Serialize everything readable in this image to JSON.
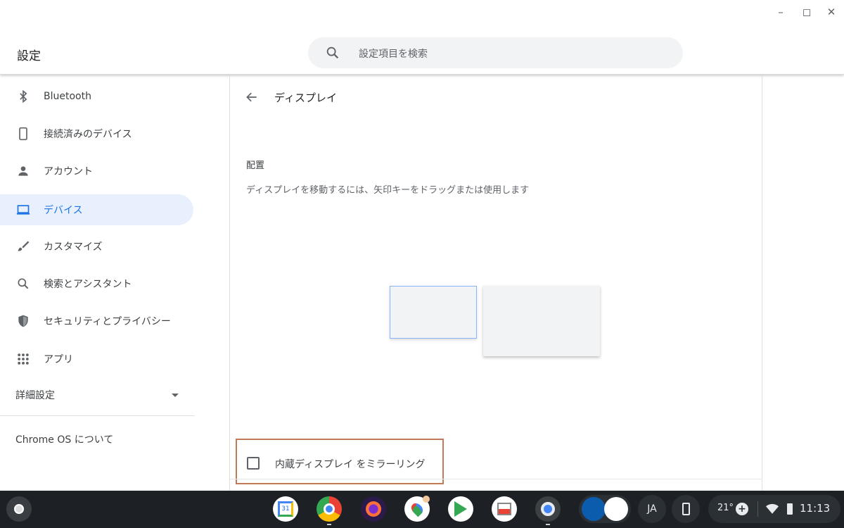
{
  "window": {
    "minimize": "–",
    "maximize": "◻",
    "close": "✕"
  },
  "header": {
    "title": "設定",
    "search_placeholder": "設定項目を検索"
  },
  "sidebar": {
    "items": [
      {
        "label": "Bluetooth",
        "icon": "bluetooth-icon"
      },
      {
        "label": "接続済みのデバイス",
        "icon": "phone-icon"
      },
      {
        "label": "アカウント",
        "icon": "person-icon"
      },
      {
        "label": "デバイス",
        "icon": "laptop-icon",
        "active": true
      },
      {
        "label": "カスタマイズ",
        "icon": "brush-icon"
      },
      {
        "label": "検索とアシスタント",
        "icon": "search-icon"
      },
      {
        "label": "セキュリティとプライバシー",
        "icon": "shield-icon"
      },
      {
        "label": "アプリ",
        "icon": "apps-grid-icon"
      }
    ],
    "advanced": "詳細設定",
    "about": "Chrome OS について"
  },
  "content": {
    "title": "ディスプレイ",
    "arrangement_heading": "配置",
    "arrangement_desc": "ディスプレイを移動するには、矢印キーをドラッグまたは使用します",
    "mirror_label": "内蔵ディスプレイ をミラーリング",
    "mirror_checked": false
  },
  "taskbar": {
    "calendar_day": "31",
    "ime": "JA",
    "temperature": "21°",
    "time": "11:13"
  },
  "colors": {
    "accent": "#1a73e8",
    "highlight_box": "#c07a55",
    "shelf": "#1d2125"
  }
}
